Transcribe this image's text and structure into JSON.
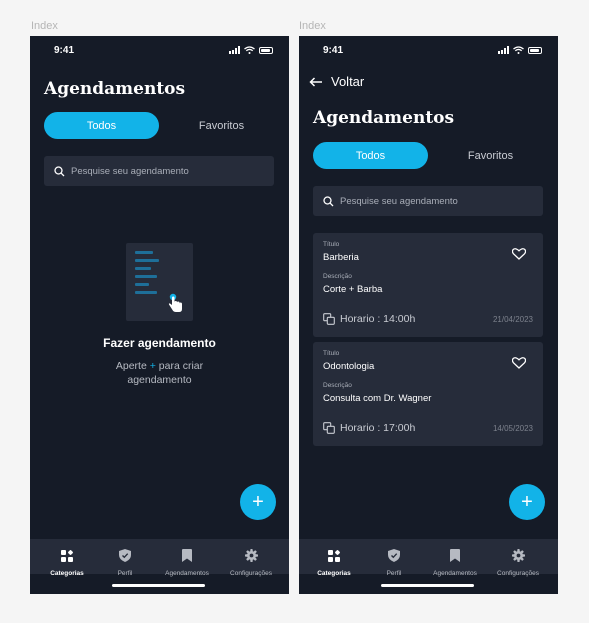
{
  "frames": [
    {
      "label": "Index"
    },
    {
      "label": "Index"
    }
  ],
  "status_bar": {
    "time": "9:41"
  },
  "screen_empty": {
    "title": "Agendamentos",
    "tabs": {
      "active": "Todos",
      "inactive": "Favoritos"
    },
    "search": {
      "placeholder": "Pesquise seu agendamento"
    },
    "empty_state": {
      "title": "Fazer agendamento",
      "desc_before": "Aperte ",
      "desc_plus": "+",
      "desc_after": " para criar agendamento"
    }
  },
  "screen_list": {
    "back_label": "Voltar",
    "title": "Agendamentos",
    "tabs": {
      "active": "Todos",
      "inactive": "Favoritos"
    },
    "search": {
      "placeholder": "Pesquise seu agendamento"
    },
    "cards": [
      {
        "title_label": "Título",
        "title": "Barberia",
        "desc_label": "Descrição",
        "desc": "Corte + Barba",
        "horario": "Horario : 14:00h",
        "date": "21/04/2023"
      },
      {
        "title_label": "Título",
        "title": "Odontologia",
        "desc_label": "Descrição",
        "desc": "Consulta com Dr. Wagner",
        "horario": "Horario : 17:00h",
        "date": "14/05/2023"
      }
    ]
  },
  "fab": {
    "label": "+"
  },
  "nav": {
    "items": [
      {
        "label": "Categorias",
        "icon": "grid-icon"
      },
      {
        "label": "Perfil",
        "icon": "shield-check-icon"
      },
      {
        "label": "Agendamentos",
        "icon": "bookmark-icon"
      },
      {
        "label": "Configurações",
        "icon": "gear-icon"
      }
    ]
  },
  "colors": {
    "accent": "#12b3e8",
    "background": "#151b27",
    "surface": "#262c3a"
  }
}
